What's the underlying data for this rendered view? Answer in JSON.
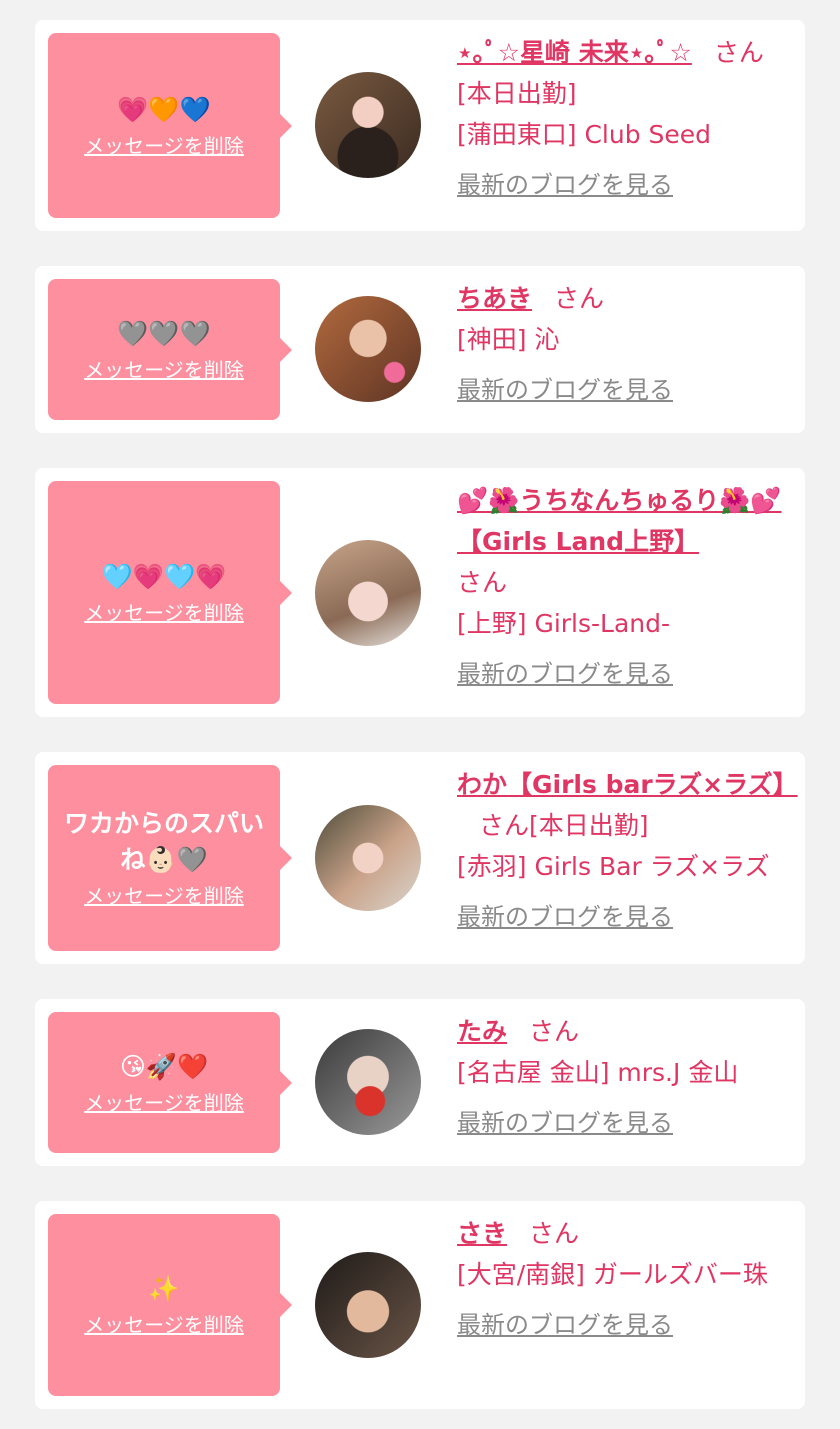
{
  "delete_label": "メッセージを削除",
  "blog_label": "最新のブログを見る",
  "honorific": "さん",
  "cards": [
    {
      "message": "💗🧡💙",
      "name": "⋆｡ﾟ☆星崎 未来⋆｡ﾟ☆",
      "status": "[本日出勤]",
      "shop": "[蒲田東口] Club Seed"
    },
    {
      "message": "🩶🩶🩶",
      "name": "ちあき",
      "shop": "[神田] 沁"
    },
    {
      "message": "🩵💗🩵💗",
      "name": "💕🌺うちなんちゅるり🌺💕【Girls Land上野】",
      "shop": "[上野] Girls-Land-"
    },
    {
      "message": "ワカからのスパいね👶🏻🩶",
      "name": "わか【Girls barラズ×ラズ】",
      "status": "[本日出勤]",
      "shop": "[赤羽] Girls Bar ラズ×ラズ"
    },
    {
      "message": "😘🚀❤️",
      "name": "たみ",
      "shop": "[名古屋 金山] mrs.J 金山"
    },
    {
      "message": "✨",
      "name": "さき",
      "shop": "[大宮/南銀] ガールズバー珠"
    }
  ],
  "colors": {
    "bubble": "#fd8f9f",
    "accent": "#e03663",
    "link_gray": "#8a8a8a",
    "background": "#f2f2f2"
  }
}
